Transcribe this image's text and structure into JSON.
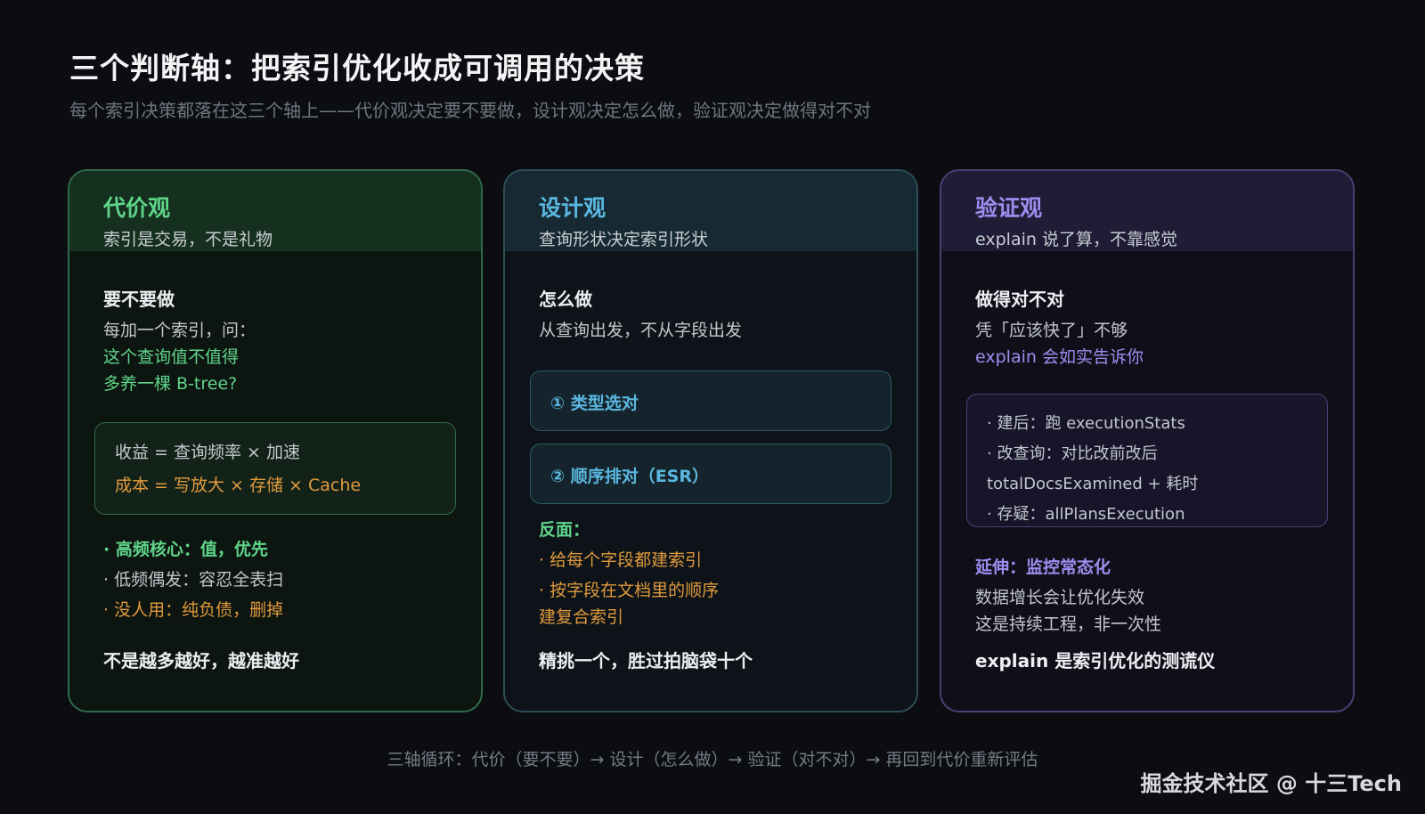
{
  "title": "三个判断轴：把索引优化收成可调用的决策",
  "subtitle": "每个索引决策都落在这三个轴上——代价观决定要不要做，设计观决定怎么做，验证观决定做得对不对",
  "cards": [
    {
      "title": "代价观",
      "tagline": "索引是交易，不是礼物",
      "section": "要不要做",
      "intro": [
        "每加一个索引，问：",
        "这个查询值不值得",
        "多养一棵 B-tree?"
      ],
      "box": [
        "收益 = 查询频率 × 加速",
        "成本 = 写放大 × 存储 × Cache"
      ],
      "bullets": [
        "· 高频核心：值，优先",
        "· 低频偶发：容忍全表扫",
        "· 没人用：纯负债，删掉"
      ],
      "conclusion": "不是越多越好，越准越好"
    },
    {
      "title": "设计观",
      "tagline": "查询形状决定索引形状",
      "section": "怎么做",
      "intro": [
        "从查询出发，不从字段出发"
      ],
      "steps": [
        "① 类型选对",
        "② 顺序排对（ESR）"
      ],
      "counter_head": "反面：",
      "counter": [
        "· 给每个字段都建索引",
        "· 按字段在文档里的顺序",
        "建复合索引"
      ],
      "conclusion": "精挑一个，胜过拍脑袋十个"
    },
    {
      "title": "验证观",
      "tagline": "explain 说了算，不靠感觉",
      "section": "做得对不对",
      "intro": [
        "凭「应该快了」不够",
        "explain 会如实告诉你"
      ],
      "box": [
        "· 建后：跑 executionStats",
        "· 改查询：对比改前改后",
        "totalDocsExamined + 耗时",
        "· 存疑：allPlansExecution"
      ],
      "extend_head": "延伸：监控常态化",
      "extend": [
        "数据增长会让优化失效",
        "这是持续工程，非一次性"
      ],
      "conclusion": "explain 是索引优化的测谎仪"
    }
  ],
  "footer": "三轴循环：代价（要不要）→ 设计（怎么做）→ 验证（对不对）→ 再回到代价重新评估",
  "watermark": "掘金技术社区 @ 十三Tech"
}
